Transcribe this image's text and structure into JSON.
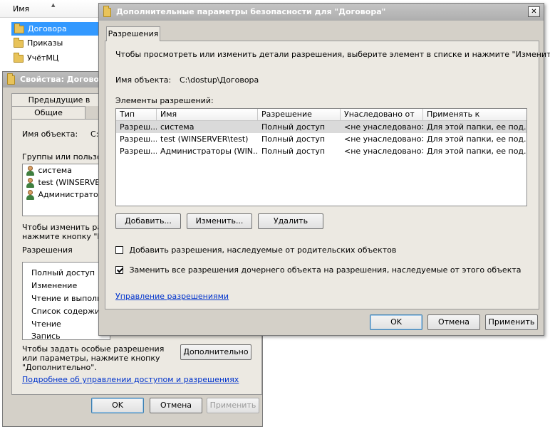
{
  "explorer": {
    "column_name": "Имя",
    "items": [
      {
        "label": "Договора",
        "selected": true
      },
      {
        "label": "Приказы",
        "selected": false
      },
      {
        "label": "УчётМЦ",
        "selected": false
      }
    ]
  },
  "props": {
    "title": "Свойства: Договор",
    "tabs": [
      "Предыдущие в",
      "Общие"
    ],
    "object_label": "Имя объекта:",
    "object_value": "C:",
    "groups_label": "Группы или пользова",
    "users": [
      "система",
      "test (WINSERVE",
      "Администраторы"
    ],
    "change_hint_1": "Чтобы изменить разр",
    "change_hint_2": "нажмите кнопку \"Изм",
    "perms_label": "Разрешения",
    "perms": [
      "Полный доступ",
      "Изменение",
      "Чтение и выполне",
      "Список содержимо",
      "Чтение",
      "Запись"
    ],
    "special_hint": "Чтобы задать особые разрешения или параметры, нажмите кнопку \"Дополнительно\".",
    "advanced_btn": "Дополнительно",
    "more_link": "Подробнее об управлении доступом и разрешениях",
    "ok": "OK",
    "cancel": "Отмена",
    "apply": "Применить"
  },
  "adv": {
    "title": "Дополнительные параметры безопасности для \"Договора\"",
    "close": "✕",
    "tab": "Разрешения",
    "info": "Чтобы просмотреть или изменить детали разрешения, выберите элемент в списке и нажмите \"Изменить\".",
    "object_label": "Имя объекта:",
    "object_value": "C:\\dostup\\Договора",
    "entries_label": "Элементы разрешений:",
    "columns": [
      "Тип",
      "Имя",
      "Разрешение",
      "Унаследовано от",
      "Применять к"
    ],
    "rows": [
      [
        "Разреш...",
        "система",
        "Полный доступ",
        "<не унаследовано>",
        "Для этой папки, ее под..."
      ],
      [
        "Разреш...",
        "test (WINSERVER\\test)",
        "Полный доступ",
        "<не унаследовано>",
        "Для этой папки, ее под..."
      ],
      [
        "Разреш...",
        "Администраторы (WIN...",
        "Полный доступ",
        "<не унаследовано>",
        "Для этой папки, ее под..."
      ]
    ],
    "add_btn": "Добавить...",
    "edit_btn": "Изменить...",
    "delete_btn": "Удалить",
    "inherit_cb": "Добавить разрешения, наследуемые от родительских объектов",
    "inherit_checked": false,
    "replace_cb": "Заменить все разрешения дочернего объекта на разрешения, наследуемые от этого объекта",
    "replace_checked": true,
    "manage_link": "Управление разрешениями",
    "ok": "OK",
    "cancel": "Отмена",
    "apply": "Применить"
  }
}
